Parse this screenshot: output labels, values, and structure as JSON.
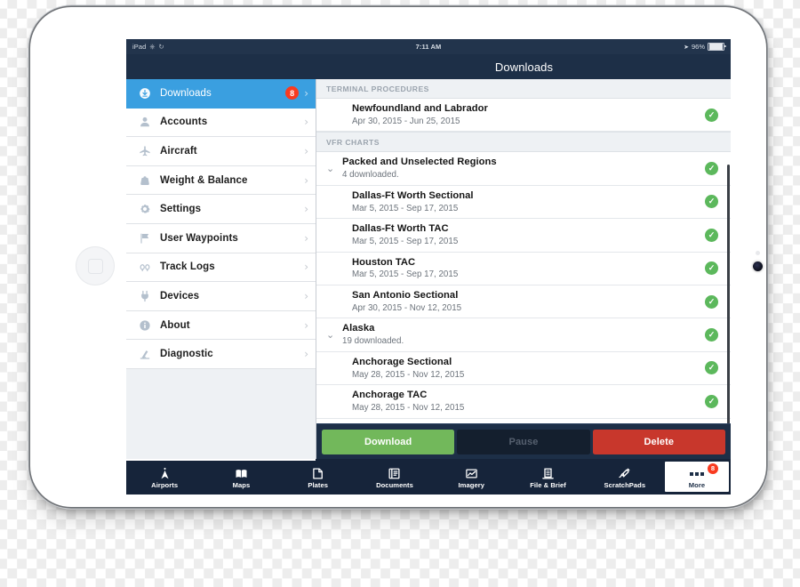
{
  "status_bar": {
    "device": "iPad",
    "icons": [
      "vpn-icon",
      "refresh-icon"
    ],
    "time": "7:11 AM",
    "location_icon": "location-arrow-icon",
    "battery_percent": "96%"
  },
  "nav": {
    "title": "Downloads"
  },
  "sidebar": {
    "items": [
      {
        "label": "Downloads",
        "icon": "download-circle-icon",
        "badge": "8",
        "selected": true
      },
      {
        "label": "Accounts",
        "icon": "person-icon",
        "badge": null,
        "selected": false
      },
      {
        "label": "Aircraft",
        "icon": "airplane-icon",
        "badge": null,
        "selected": false
      },
      {
        "label": "Weight & Balance",
        "icon": "weight-icon",
        "badge": null,
        "selected": false
      },
      {
        "label": "Settings",
        "icon": "gear-icon",
        "badge": null,
        "selected": false
      },
      {
        "label": "User Waypoints",
        "icon": "flag-icon",
        "badge": null,
        "selected": false
      },
      {
        "label": "Track Logs",
        "icon": "track-log-icon",
        "badge": null,
        "selected": false
      },
      {
        "label": "Devices",
        "icon": "plug-icon",
        "badge": null,
        "selected": false
      },
      {
        "label": "About",
        "icon": "info-circle-icon",
        "badge": null,
        "selected": false
      },
      {
        "label": "Diagnostic",
        "icon": "microscope-icon",
        "badge": null,
        "selected": false
      }
    ]
  },
  "main": {
    "sections": [
      {
        "header": "TERMINAL PROCEDURES",
        "rows": [
          {
            "type": "item",
            "title": "Newfoundland and Labrador",
            "subtitle": "Apr 30, 2015 - Jun 25, 2015",
            "status": "downloaded"
          }
        ]
      },
      {
        "header": "VFR CHARTS",
        "rows": [
          {
            "type": "group",
            "title": "Packed and Unselected Regions",
            "subtitle": "4 downloaded.",
            "status": "downloaded",
            "expanded": true
          },
          {
            "type": "item",
            "title": "Dallas-Ft Worth Sectional",
            "subtitle": "Mar 5, 2015 - Sep 17, 2015",
            "status": "downloaded"
          },
          {
            "type": "item",
            "title": "Dallas-Ft Worth TAC",
            "subtitle": "Mar 5, 2015 - Sep 17, 2015",
            "status": "downloaded"
          },
          {
            "type": "item",
            "title": "Houston TAC",
            "subtitle": "Mar 5, 2015 - Sep 17, 2015",
            "status": "downloaded"
          },
          {
            "type": "item",
            "title": "San Antonio Sectional",
            "subtitle": "Apr 30, 2015 - Nov 12, 2015",
            "status": "downloaded"
          },
          {
            "type": "group",
            "title": "Alaska",
            "subtitle": "19 downloaded.",
            "status": "downloaded",
            "expanded": true
          },
          {
            "type": "item",
            "title": "Anchorage Sectional",
            "subtitle": "May 28, 2015 - Nov 12, 2015",
            "status": "downloaded"
          },
          {
            "type": "item",
            "title": "Anchorage TAC",
            "subtitle": "May 28, 2015 - Nov 12, 2015",
            "status": "downloaded"
          }
        ]
      }
    ]
  },
  "actions": {
    "download_label": "Download",
    "pause_label": "Pause",
    "delete_label": "Delete"
  },
  "tabbar": {
    "tabs": [
      {
        "label": "Airports",
        "icon": "compass-rose-icon",
        "selected": false,
        "badge": null
      },
      {
        "label": "Maps",
        "icon": "open-map-icon",
        "selected": false,
        "badge": null
      },
      {
        "label": "Plates",
        "icon": "plate-page-icon",
        "selected": false,
        "badge": null
      },
      {
        "label": "Documents",
        "icon": "documents-icon",
        "selected": false,
        "badge": null
      },
      {
        "label": "Imagery",
        "icon": "imagery-chart-icon",
        "selected": false,
        "badge": null
      },
      {
        "label": "File & Brief",
        "icon": "file-brief-icon",
        "selected": false,
        "badge": null
      },
      {
        "label": "ScratchPads",
        "icon": "pen-scratchpad-icon",
        "selected": false,
        "badge": null
      },
      {
        "label": "More",
        "icon": "ellipsis-icon",
        "selected": true,
        "badge": "8"
      }
    ]
  },
  "colors": {
    "navy": "#1d2f47",
    "accent_blue": "#3a9fe0",
    "badge_red": "#f93b20",
    "download_green": "#72b85b",
    "delete_red": "#c8372c",
    "check_green": "#5cb85c"
  }
}
